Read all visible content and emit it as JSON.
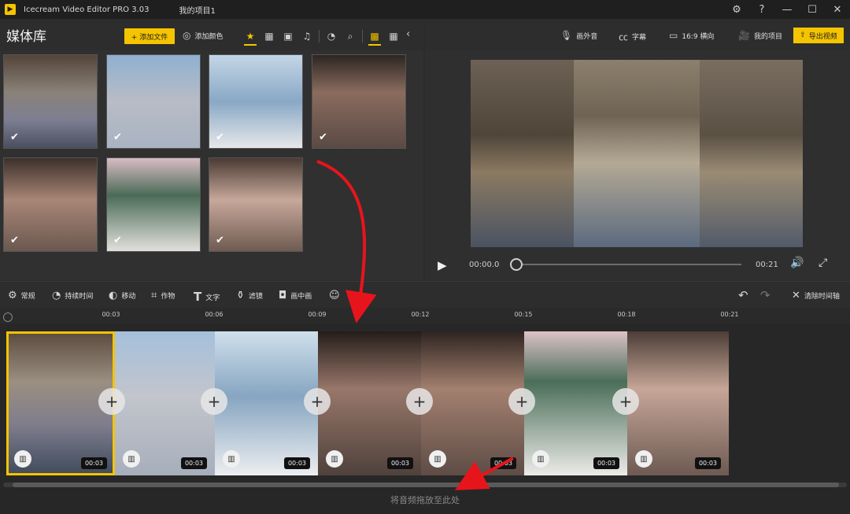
{
  "window": {
    "app_title": "Icecream Video Editor PRO 3.03",
    "project_title": "我的项目1",
    "buttons": [
      "gear-icon",
      "help-icon",
      "minimize-icon",
      "maximize-icon",
      "close-icon"
    ]
  },
  "library": {
    "title": "媒体库",
    "add_file_label": "+ 添加文件",
    "add_color_label": "添加颜色",
    "tools": [
      "star-icon",
      "film-icon",
      "image-icon",
      "music-icon",
      "clock-icon",
      "search-icon",
      "grid-large-icon",
      "grid-small-icon"
    ],
    "thumbnails": [
      {
        "checked": true,
        "color": "#7d7e92"
      },
      {
        "checked": true,
        "color": "#a9b3c2"
      },
      {
        "checked": true,
        "color": "#89a8c5"
      },
      {
        "checked": true,
        "color": "#5a4a44"
      },
      {
        "checked": true,
        "color": "#6b5850"
      },
      {
        "checked": true,
        "color": "#8b8377"
      },
      {
        "checked": true,
        "color": "#6f5b52"
      }
    ]
  },
  "preview": {
    "voiceover_label": "画外音",
    "subtitles_label": "字幕",
    "aspect_label": "16:9 横向",
    "my_projects_label": "我的项目",
    "export_label": "导出视频",
    "time_current": "00:00.0",
    "time_total": "00:21",
    "progress": 0
  },
  "toolbar": {
    "general": "常规",
    "duration": "持续时间",
    "move": "移动",
    "crop": "作物",
    "text": "文字",
    "filter": "滤镜",
    "pip": "画中画",
    "clear_timeline": "清除时间轴"
  },
  "timeline": {
    "ticks": [
      "00:03",
      "00:06",
      "00:09",
      "00:12",
      "00:15",
      "00:18",
      "00:21"
    ],
    "clips": [
      {
        "duration": "00:03",
        "color": "#7f7d8c",
        "selected": true
      },
      {
        "duration": "00:03",
        "color": "#a7aebb",
        "selected": false
      },
      {
        "duration": "00:03",
        "color": "#87a5c1",
        "selected": false
      },
      {
        "duration": "00:03",
        "color": "#4f413c",
        "selected": false
      },
      {
        "duration": "00:03",
        "color": "#5e4c46",
        "selected": false
      },
      {
        "duration": "00:03",
        "color": "#8a8a80",
        "selected": false
      },
      {
        "duration": "00:03",
        "color": "#6d5a52",
        "selected": false
      }
    ],
    "audio_hint": "将音频拖放至此处"
  },
  "colors": {
    "accent": "#f5c400",
    "arrow": "#e8141c"
  }
}
